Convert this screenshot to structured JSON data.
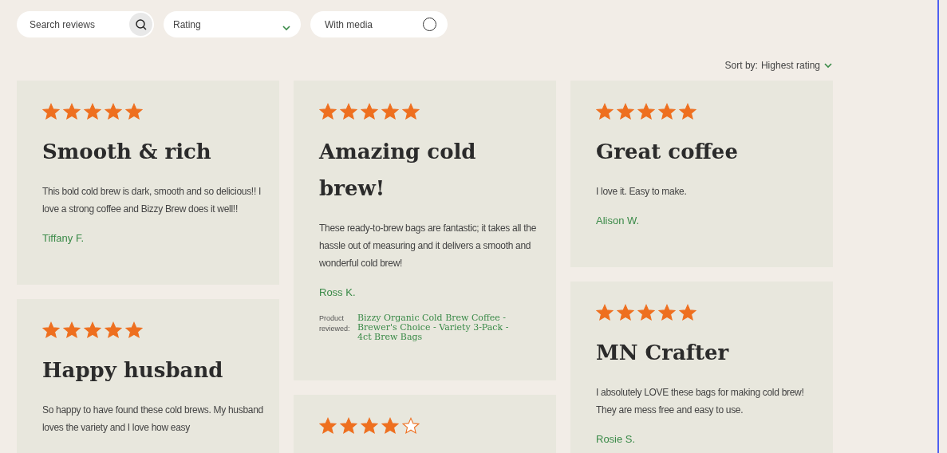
{
  "filters": {
    "search": {
      "placeholder": "Search reviews"
    },
    "rating": {
      "label": "Rating"
    },
    "with_media": {
      "label": "With media",
      "checked": false
    }
  },
  "sort": {
    "label": "Sort by:",
    "value": "Highest rating"
  },
  "columns": [
    {
      "reviews": [
        {
          "stars": 5,
          "title": "Smooth & rich",
          "body": "This bold cold brew is dark, smooth and so delicious!! I love a strong coffee and Bizzy Brew does it well!!",
          "author": "Tiffany F."
        },
        {
          "stars": 5,
          "title": "Happy husband",
          "body": "So happy to have found these cold brews. My husband loves the variety and I love how easy"
        }
      ]
    },
    {
      "reviews": [
        {
          "stars": 5,
          "title": "Amazing cold brew!",
          "body": "These ready-to-brew bags are fantastic; it takes all the hassle out of measuring and it delivers a smooth and wonderful cold brew!",
          "author": "Ross K.",
          "product_label": "Product reviewed:",
          "product": "Bizzy Organic Cold Brew Coffee - Brewer's Choice - Variety 3-Pack - 4ct Brew Bags"
        },
        {
          "stars": 4
        }
      ]
    },
    {
      "reviews": [
        {
          "stars": 5,
          "title": "Great coffee",
          "body": "I love it. Easy to make.",
          "author": "Alison W."
        },
        {
          "stars": 5,
          "title": "MN Crafter",
          "body": "I absolutely LOVE these bags for making cold brew! They are mess free and easy to use.",
          "author": "Rosie S."
        }
      ]
    }
  ]
}
